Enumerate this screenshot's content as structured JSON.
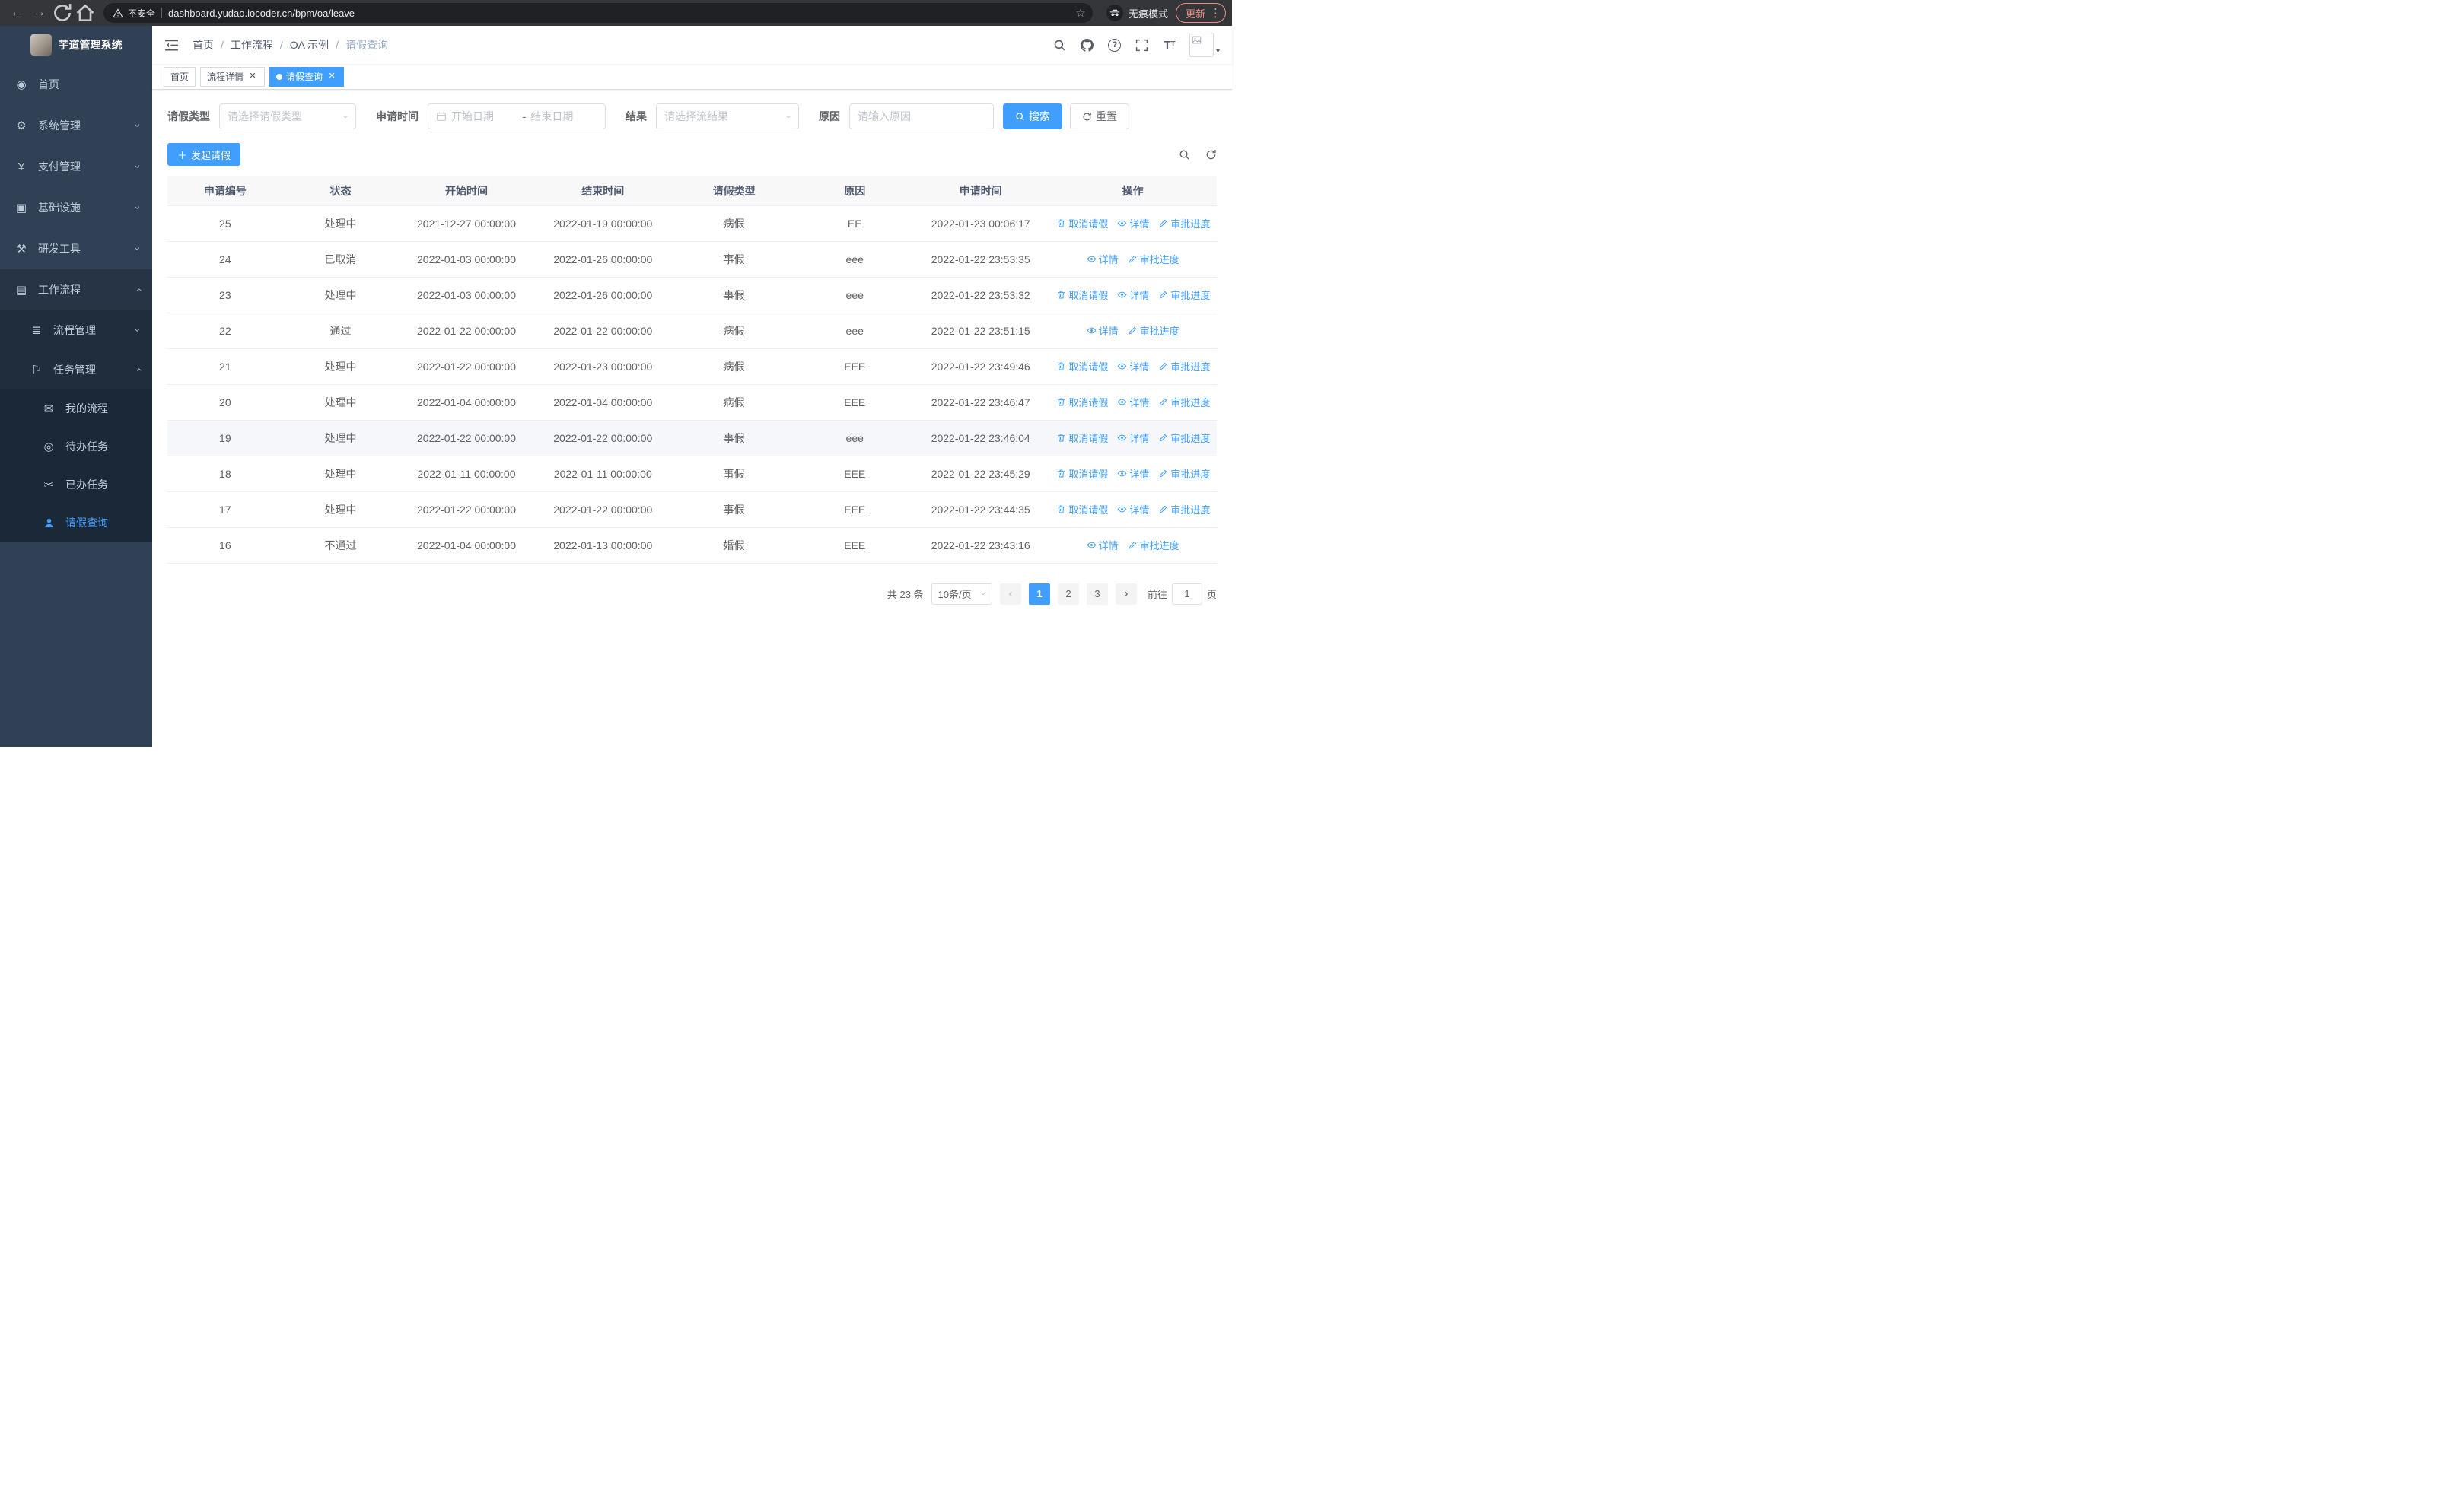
{
  "colors": {
    "primary": "#409eff",
    "sidebar_bg": "#304156",
    "sidebar_submenu_bg": "#1f2d3d",
    "sidebar_text": "#bfcbd9",
    "active_text": "#409eff",
    "chrome_bg": "#35363a",
    "update_pill": "#ec8e85"
  },
  "browser": {
    "security_label": "不安全",
    "url": "dashboard.yudao.iocoder.cn/bpm/oa/leave",
    "incognito_label": "无痕模式",
    "update_label": "更新"
  },
  "sidebar": {
    "title": "芋道管理系统",
    "items": [
      {
        "label": "首页",
        "icon": "dashboard-icon",
        "glyph": "◉"
      },
      {
        "label": "系统管理",
        "icon": "gear-icon",
        "glyph": "⚙"
      },
      {
        "label": "支付管理",
        "icon": "yen-icon",
        "glyph": "¥"
      },
      {
        "label": "基础设施",
        "icon": "infrastructure-icon",
        "glyph": "▣"
      },
      {
        "label": "研发工具",
        "icon": "tools-icon",
        "glyph": "⚒"
      },
      {
        "label": "工作流程",
        "icon": "workflow-icon",
        "glyph": "▤"
      },
      {
        "label": "流程管理",
        "icon": "process-management-icon",
        "glyph": "≣"
      },
      {
        "label": "任务管理",
        "icon": "task-management-icon",
        "glyph": "⚐"
      },
      {
        "label": "我的流程",
        "icon": "my-process-icon",
        "glyph": "✉"
      },
      {
        "label": "待办任务",
        "icon": "todo-task-icon",
        "glyph": "◎"
      },
      {
        "label": "已办任务",
        "icon": "done-task-icon",
        "glyph": "✂"
      },
      {
        "label": "请假查询",
        "icon": "user-icon",
        "glyph": ""
      }
    ]
  },
  "breadcrumb": [
    "首页",
    "工作流程",
    "OA 示例",
    "请假查询"
  ],
  "tabs": [
    {
      "label": "首页"
    },
    {
      "label": "流程详情"
    },
    {
      "label": "请假查询"
    }
  ],
  "filters": {
    "leave_type_label": "请假类型",
    "leave_type_placeholder": "请选择请假类型",
    "apply_time_label": "申请时间",
    "date_start_placeholder": "开始日期",
    "date_separator": "-",
    "date_end_placeholder": "结束日期",
    "result_label": "结果",
    "result_placeholder": "请选择流结果",
    "reason_label": "原因",
    "reason_placeholder": "请输入原因",
    "search_label": "搜索",
    "reset_label": "重置"
  },
  "toolbar": {
    "create_label": "发起请假"
  },
  "table": {
    "columns": [
      "申请编号",
      "状态",
      "开始时间",
      "结束时间",
      "请假类型",
      "原因",
      "申请时间",
      "操作"
    ],
    "action_labels": {
      "cancel": "取消请假",
      "detail": "详情",
      "progress": "审批进度"
    },
    "rows": [
      {
        "id": "25",
        "status": "处理中",
        "start": "2021-12-27 00:00:00",
        "end": "2022-01-19 00:00:00",
        "type": "病假",
        "reason": "EE",
        "applied": "2022-01-23 00:06:17",
        "actions": [
          "cancel",
          "detail",
          "progress"
        ],
        "highlighted": false
      },
      {
        "id": "24",
        "status": "已取消",
        "start": "2022-01-03 00:00:00",
        "end": "2022-01-26 00:00:00",
        "type": "事假",
        "reason": "eee",
        "applied": "2022-01-22 23:53:35",
        "actions": [
          "detail",
          "progress"
        ],
        "highlighted": false
      },
      {
        "id": "23",
        "status": "处理中",
        "start": "2022-01-03 00:00:00",
        "end": "2022-01-26 00:00:00",
        "type": "事假",
        "reason": "eee",
        "applied": "2022-01-22 23:53:32",
        "actions": [
          "cancel",
          "detail",
          "progress"
        ],
        "highlighted": false
      },
      {
        "id": "22",
        "status": "通过",
        "start": "2022-01-22 00:00:00",
        "end": "2022-01-22 00:00:00",
        "type": "病假",
        "reason": "eee",
        "applied": "2022-01-22 23:51:15",
        "actions": [
          "detail",
          "progress"
        ],
        "highlighted": false
      },
      {
        "id": "21",
        "status": "处理中",
        "start": "2022-01-22 00:00:00",
        "end": "2022-01-23 00:00:00",
        "type": "病假",
        "reason": "EEE",
        "applied": "2022-01-22 23:49:46",
        "actions": [
          "cancel",
          "detail",
          "progress"
        ],
        "highlighted": false
      },
      {
        "id": "20",
        "status": "处理中",
        "start": "2022-01-04 00:00:00",
        "end": "2022-01-04 00:00:00",
        "type": "病假",
        "reason": "EEE",
        "applied": "2022-01-22 23:46:47",
        "actions": [
          "cancel",
          "detail",
          "progress"
        ],
        "highlighted": false
      },
      {
        "id": "19",
        "status": "处理中",
        "start": "2022-01-22 00:00:00",
        "end": "2022-01-22 00:00:00",
        "type": "事假",
        "reason": "eee",
        "applied": "2022-01-22 23:46:04",
        "actions": [
          "cancel",
          "detail",
          "progress"
        ],
        "highlighted": true
      },
      {
        "id": "18",
        "status": "处理中",
        "start": "2022-01-11 00:00:00",
        "end": "2022-01-11 00:00:00",
        "type": "事假",
        "reason": "EEE",
        "applied": "2022-01-22 23:45:29",
        "actions": [
          "cancel",
          "detail",
          "progress"
        ],
        "highlighted": false
      },
      {
        "id": "17",
        "status": "处理中",
        "start": "2022-01-22 00:00:00",
        "end": "2022-01-22 00:00:00",
        "type": "事假",
        "reason": "EEE",
        "applied": "2022-01-22 23:44:35",
        "actions": [
          "cancel",
          "detail",
          "progress"
        ],
        "highlighted": false
      },
      {
        "id": "16",
        "status": "不通过",
        "start": "2022-01-04 00:00:00",
        "end": "2022-01-13 00:00:00",
        "type": "婚假",
        "reason": "EEE",
        "applied": "2022-01-22 23:43:16",
        "actions": [
          "detail",
          "progress"
        ],
        "highlighted": false
      }
    ]
  },
  "pagination": {
    "total_label": "共 23 条",
    "page_size": "10条/页",
    "pages": [
      "1",
      "2",
      "3"
    ],
    "active_page": "1",
    "goto_label": "前往",
    "goto_value": "1",
    "page_unit": "页"
  }
}
